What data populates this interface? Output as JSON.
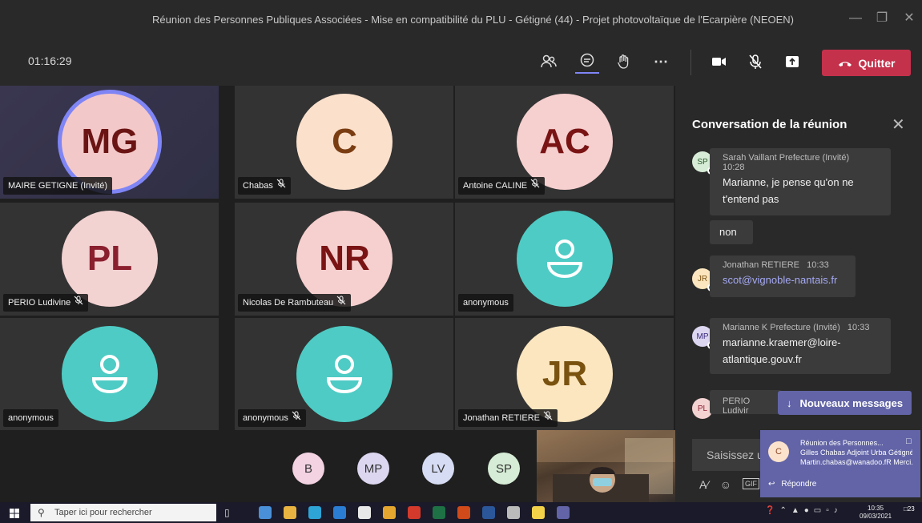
{
  "window": {
    "title": "Réunion des Personnes Publiques Associées - Mise en compatibilité du PLU - Gétigné (44) - Projet photovoltaïque de l'Ecarpière (NEOEN)",
    "icons": [
      "minimize-icon",
      "restore-icon",
      "close-icon"
    ]
  },
  "toolbar": {
    "timer": "01:16:29",
    "icons": [
      "participants-icon",
      "chat-icon",
      "raise-hand-icon",
      "more-icon",
      "camera-icon",
      "mic-off-icon",
      "share-icon"
    ],
    "quit_label": "Quitter"
  },
  "participants": [
    {
      "initials": "MG",
      "name": "MAIRE GETIGNE (Invité)",
      "bg": "#f3c8c8",
      "fg": "#6b1414",
      "muted": false,
      "speaking": true
    },
    {
      "initials": "C",
      "name": "Chabas",
      "bg": "#fbe0cc",
      "fg": "#7a3d12",
      "muted": true
    },
    {
      "initials": "AC",
      "name": "Antoine CALINE",
      "bg": "#f6cfcf",
      "fg": "#7a1414",
      "muted": true
    },
    {
      "initials": "PL",
      "name": "PERIO Ludivine",
      "bg": "#f3d2d2",
      "fg": "#8a1f2e",
      "muted": true
    },
    {
      "initials": "NR",
      "name": "Nicolas De Rambuteau",
      "bg": "#f6cfcf",
      "fg": "#7a1414",
      "muted": true
    },
    {
      "initials": "",
      "name": "anonymous",
      "bg": "#4ecbc4",
      "fg": "#ffffff",
      "muted": false,
      "anon": true
    },
    {
      "initials": "",
      "name": "anonymous",
      "bg": "#4ecbc4",
      "fg": "#ffffff",
      "muted": false,
      "anon": true
    },
    {
      "initials": "",
      "name": "anonymous",
      "bg": "#4ecbc4",
      "fg": "#ffffff",
      "muted": true,
      "anon": true
    },
    {
      "initials": "JR",
      "name": "Jonathan RETIERE",
      "bg": "#fbe6bf",
      "fg": "#7a5210",
      "muted": true
    }
  ],
  "overflow_participants": [
    {
      "initials": "B",
      "bg": "#f3d2e2"
    },
    {
      "initials": "MP",
      "bg": "#dcd6f0"
    },
    {
      "initials": "LV",
      "bg": "#d6dcf3"
    },
    {
      "initials": "SP",
      "bg": "#d6ecd6"
    }
  ],
  "chat": {
    "title": "Conversation de la réunion",
    "messages": [
      {
        "initials": "SP",
        "avbg": "#d6ecd6",
        "author": "Sarah Vaillant Prefecture (Invité)",
        "time": "10:28",
        "body": "Marianne, je pense qu'on ne t'entend pas",
        "link": false
      },
      {
        "initials": "",
        "avbg": "",
        "author": "",
        "time": "",
        "body": "non",
        "link": false
      },
      {
        "initials": "JR",
        "avbg": "#fbe6bf",
        "author": "Jonathan RETIERE",
        "time": "10:33",
        "body": "scot@vignoble-nantais.fr",
        "link": true
      },
      {
        "initials": "MP",
        "avbg": "#dcd6f0",
        "author": "Marianne K Prefecture (Invité)",
        "time": "10:33",
        "body": "marianne.kraemer@loire-atlantique.gouv.fr",
        "link": false
      },
      {
        "initials": "PL",
        "avbg": "#f3d2d2",
        "author": "PERIO Ludivir",
        "time": "",
        "body": "",
        "link": false
      }
    ],
    "new_messages_label": "Nouveaux messages",
    "compose_placeholder": "Saisissez un",
    "compose_icons": [
      "format-icon",
      "emoji-icon",
      "gif-icon"
    ]
  },
  "toast": {
    "initials": "C",
    "title": "Réunion des Personnes...",
    "line1": "Gilles Chabas Adjoint Urba Gétigné",
    "line2": "Martin.chabas@wanadoo.fR Merci...",
    "reply_label": "Répondre"
  },
  "taskbar": {
    "search_placeholder": "Taper ici pour rechercher",
    "time": "10:35",
    "date": "09/03/2021",
    "notif_count": "23"
  }
}
